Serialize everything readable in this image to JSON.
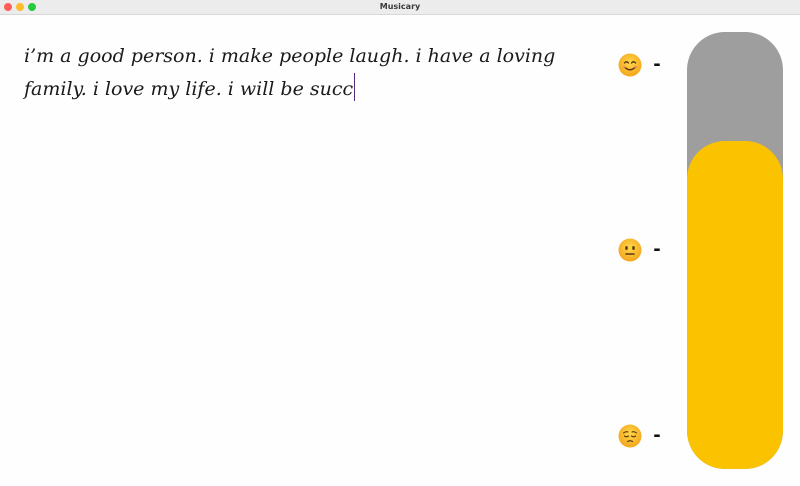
{
  "window": {
    "title": "Musicary"
  },
  "editor": {
    "text": "i’m a good person. i make people laugh. i have a loving family. i love my life. i will be succ"
  },
  "mood_scale": {
    "levels": [
      {
        "icon": "smiling-face-icon",
        "label": "-"
      },
      {
        "icon": "neutral-face-icon",
        "label": "-"
      },
      {
        "icon": "pensive-face-icon",
        "label": "-"
      }
    ],
    "meter_level": 0.75,
    "colors": {
      "track": "#9e9e9e",
      "fill": "#fbc200"
    }
  }
}
